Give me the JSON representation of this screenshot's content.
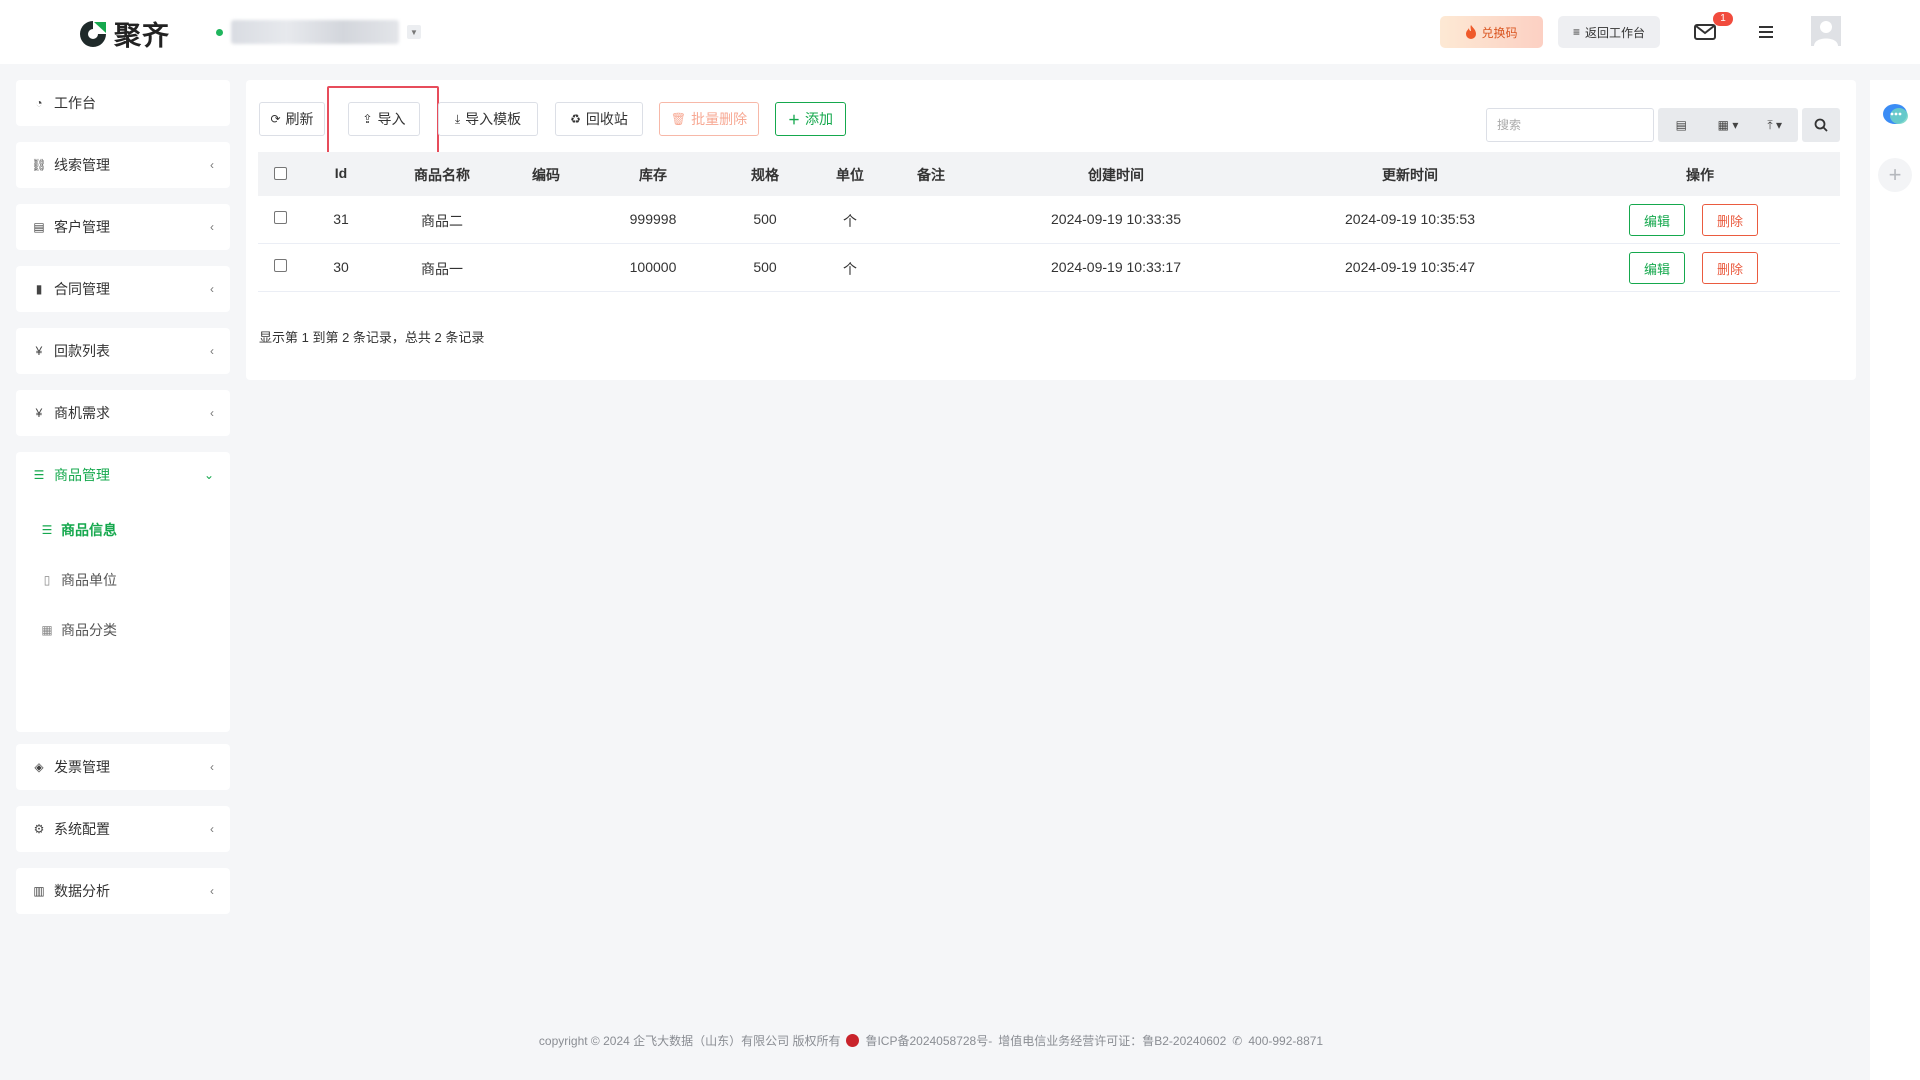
{
  "brand": {
    "name": "聚齐",
    "accent": "#15a84d"
  },
  "header": {
    "redeem_label": "兑换码",
    "back_label": "返回工作台",
    "mail_badge": "1"
  },
  "sidebar": {
    "items": [
      {
        "label": "工作台",
        "icon": "dashboard-icon"
      },
      {
        "label": "线索管理",
        "icon": "link-icon"
      },
      {
        "label": "客户管理",
        "icon": "id-card-icon"
      },
      {
        "label": "合同管理",
        "icon": "bookmark-icon"
      },
      {
        "label": "回款列表",
        "icon": "yen-icon"
      },
      {
        "label": "商机需求",
        "icon": "yen-icon"
      },
      {
        "label": "商品管理",
        "icon": "list-icon",
        "expanded": true
      },
      {
        "label": "发票管理",
        "icon": "tag-icon"
      },
      {
        "label": "系统配置",
        "icon": "gears-icon"
      },
      {
        "label": "数据分析",
        "icon": "bar-chart-icon"
      }
    ],
    "sub_items": [
      {
        "label": "商品信息",
        "icon": "list-icon",
        "active": true
      },
      {
        "label": "商品单位",
        "icon": "file-icon"
      },
      {
        "label": "商品分类",
        "icon": "calendar-icon"
      }
    ]
  },
  "toolbar": {
    "refresh": "刷新",
    "import": "导入",
    "import_template": "导入模板",
    "recycle": "回收站",
    "batch_delete": "批量删除",
    "add": "添加",
    "search_placeholder": "搜索"
  },
  "table": {
    "columns": [
      "Id",
      "商品名称",
      "编码",
      "库存",
      "规格",
      "单位",
      "备注",
      "创建时间",
      "更新时间",
      "操作"
    ],
    "rows": [
      {
        "id": "31",
        "name": "商品二",
        "code": "",
        "stock": "999998",
        "spec": "500",
        "unit": "个",
        "remark": "",
        "created": "2024-09-19 10:33:35",
        "updated": "2024-09-19 10:35:53"
      },
      {
        "id": "30",
        "name": "商品一",
        "code": "",
        "stock": "100000",
        "spec": "500",
        "unit": "个",
        "remark": "",
        "created": "2024-09-19 10:33:17",
        "updated": "2024-09-19 10:35:47"
      }
    ],
    "edit_label": "编辑",
    "delete_label": "删除"
  },
  "pager_info": "显示第 1 到第 2 条记录，总共 2 条记录",
  "footer": {
    "copyright": "copyright © 2024 企飞大数据（山东）有限公司 版权所有",
    "icp": "鲁ICP备2024058728号-",
    "license": "增值电信业务经营许可证：鲁B2-20240602",
    "phone": "400-992-8871"
  }
}
